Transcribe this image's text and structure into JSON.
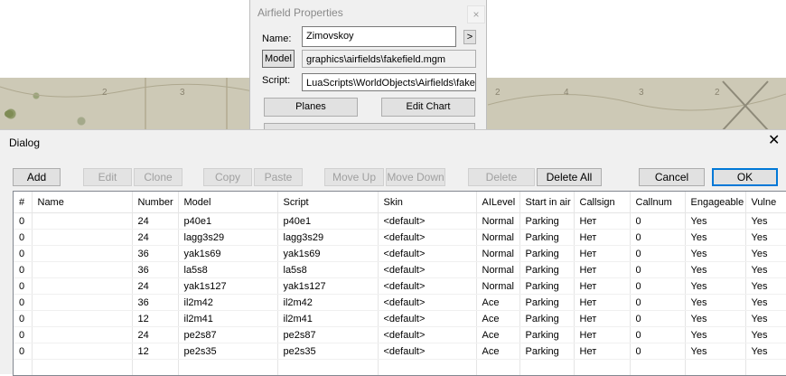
{
  "airfield": {
    "title": "Airfield Properties",
    "close_glyph": "×",
    "name_label": "Name:",
    "name_value": "Zimovskoy",
    "more_glyph": ">",
    "model_button": "Model",
    "model_value": "graphics\\airfields\\fakefield.mgm",
    "script_label": "Script:",
    "script_value": "LuaScripts\\WorldObjects\\Airfields\\fake",
    "planes_button": "Planes",
    "edit_chart_button": "Edit Chart"
  },
  "map": {
    "labels": [
      "2",
      "3",
      "2",
      "4",
      "3",
      "2",
      "3"
    ]
  },
  "dialog": {
    "title": "Dialog",
    "close_glyph": "✕",
    "buttons": {
      "add": "Add",
      "edit": "Edit",
      "clone": "Clone",
      "copy": "Copy",
      "paste": "Paste",
      "move_up": "Move Up",
      "move_down": "Move Down",
      "delete": "Delete",
      "delete_all": "Delete All",
      "cancel": "Cancel",
      "ok": "OK"
    },
    "columns": [
      "#",
      "Name",
      "Number",
      "Model",
      "Script",
      "Skin",
      "AILevel",
      "Start in air",
      "Callsign",
      "Callnum",
      "Engageable",
      "Vulne"
    ],
    "rows": [
      [
        "0",
        "",
        "24",
        "p40e1",
        "p40e1",
        "<default>",
        "Normal",
        "Parking",
        "Нет",
        "0",
        "Yes",
        "Yes"
      ],
      [
        "0",
        "",
        "24",
        "lagg3s29",
        "lagg3s29",
        "<default>",
        "Normal",
        "Parking",
        "Нет",
        "0",
        "Yes",
        "Yes"
      ],
      [
        "0",
        "",
        "36",
        "yak1s69",
        "yak1s69",
        "<default>",
        "Normal",
        "Parking",
        "Нет",
        "0",
        "Yes",
        "Yes"
      ],
      [
        "0",
        "",
        "36",
        "la5s8",
        "la5s8",
        "<default>",
        "Normal",
        "Parking",
        "Нет",
        "0",
        "Yes",
        "Yes"
      ],
      [
        "0",
        "",
        "24",
        "yak1s127",
        "yak1s127",
        "<default>",
        "Normal",
        "Parking",
        "Нет",
        "0",
        "Yes",
        "Yes"
      ],
      [
        "0",
        "",
        "36",
        "il2m42",
        "il2m42",
        "<default>",
        "Ace",
        "Parking",
        "Нет",
        "0",
        "Yes",
        "Yes"
      ],
      [
        "0",
        "",
        "12",
        "il2m41",
        "il2m41",
        "<default>",
        "Ace",
        "Parking",
        "Нет",
        "0",
        "Yes",
        "Yes"
      ],
      [
        "0",
        "",
        "24",
        "pe2s87",
        "pe2s87",
        "<default>",
        "Ace",
        "Parking",
        "Нет",
        "0",
        "Yes",
        "Yes"
      ],
      [
        "0",
        "",
        "12",
        "pe2s35",
        "pe2s35",
        "<default>",
        "Ace",
        "Parking",
        "Нет",
        "0",
        "Yes",
        "Yes"
      ],
      [
        "",
        "",
        "",
        "",
        "",
        "",
        "",
        "",
        "",
        "",
        "",
        ""
      ]
    ]
  }
}
